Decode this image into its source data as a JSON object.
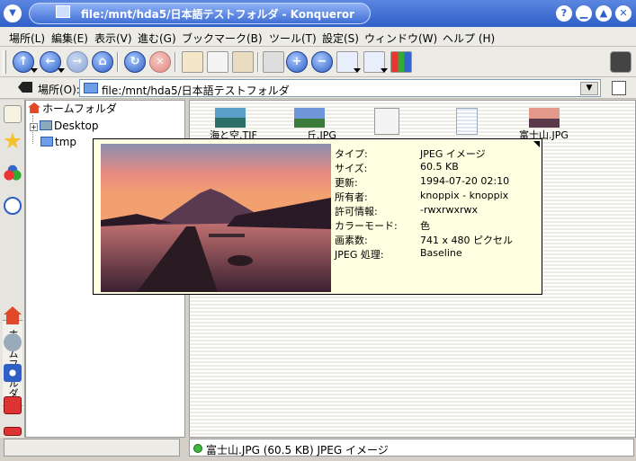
{
  "window": {
    "title": "file:/mnt/hda5/日本語テストフォルダ - Konqueror",
    "menu_glyph": "▼",
    "help_glyph": "?",
    "minimize_glyph": "▁",
    "maximize_glyph": "▲",
    "close_glyph": "✕"
  },
  "menubar": {
    "items": [
      "場所(L)",
      "編集(E)",
      "表示(V)",
      "進む(G)",
      "ブックマーク(B)",
      "ツール(T)",
      "設定(S)",
      "ウィンドウ(W)",
      "ヘルプ (H)"
    ]
  },
  "toolbar": {
    "buttons": [
      "up-icon",
      "back-icon",
      "forward-icon",
      "home-icon",
      "reload-icon",
      "stop-icon",
      "cut-icon",
      "copy-icon",
      "paste-icon",
      "print-icon",
      "zoom-in-icon",
      "zoom-out-icon",
      "icon-view-icon",
      "tree-view-icon",
      "preview-icon",
      "settings-icon"
    ]
  },
  "location": {
    "label": "場所(O):",
    "url": "file:/mnt/hda5/日本語テストフォルダ",
    "dropdown_glyph": "▼"
  },
  "sidebar": {
    "vertical_label": "ホームフォルダ"
  },
  "tree": {
    "root": "ホームフォルダ",
    "expander": "+",
    "children": [
      "Desktop",
      "tmp"
    ]
  },
  "files": [
    {
      "name": "海と空.TIF",
      "icon": "image-thumb"
    },
    {
      "name": "丘.JPG",
      "icon": "image-thumb"
    },
    {
      "name": "",
      "icon": "text-doc-icon"
    },
    {
      "name": "",
      "icon": "blank-doc-icon"
    },
    {
      "name": "富士山.JPG",
      "icon": "image-thumb"
    }
  ],
  "tooltip": {
    "rows": [
      {
        "key": "タイプ:",
        "value": "JPEG イメージ"
      },
      {
        "key": "サイズ:",
        "value": "60.5 KB"
      },
      {
        "key": "更新:",
        "value": "1994-07-20 02:10"
      },
      {
        "key": "所有者:",
        "value": "knoppix - knoppix"
      },
      {
        "key": "許可情報:",
        "value": "-rwxrwxrwx"
      },
      {
        "key": "カラーモード:",
        "value": "色"
      },
      {
        "key": "画素数:",
        "value": "741 x 480 ピクセル"
      },
      {
        "key": "JPEG 処理:",
        "value": "Baseline"
      }
    ]
  },
  "status": {
    "text": "富士山.JPG (60.5 KB)  JPEG イメージ"
  },
  "colors": {
    "titlebar": "#3f6fd6",
    "tooltip_bg": "#ffffe1",
    "status_ok": "#3cb83a"
  }
}
